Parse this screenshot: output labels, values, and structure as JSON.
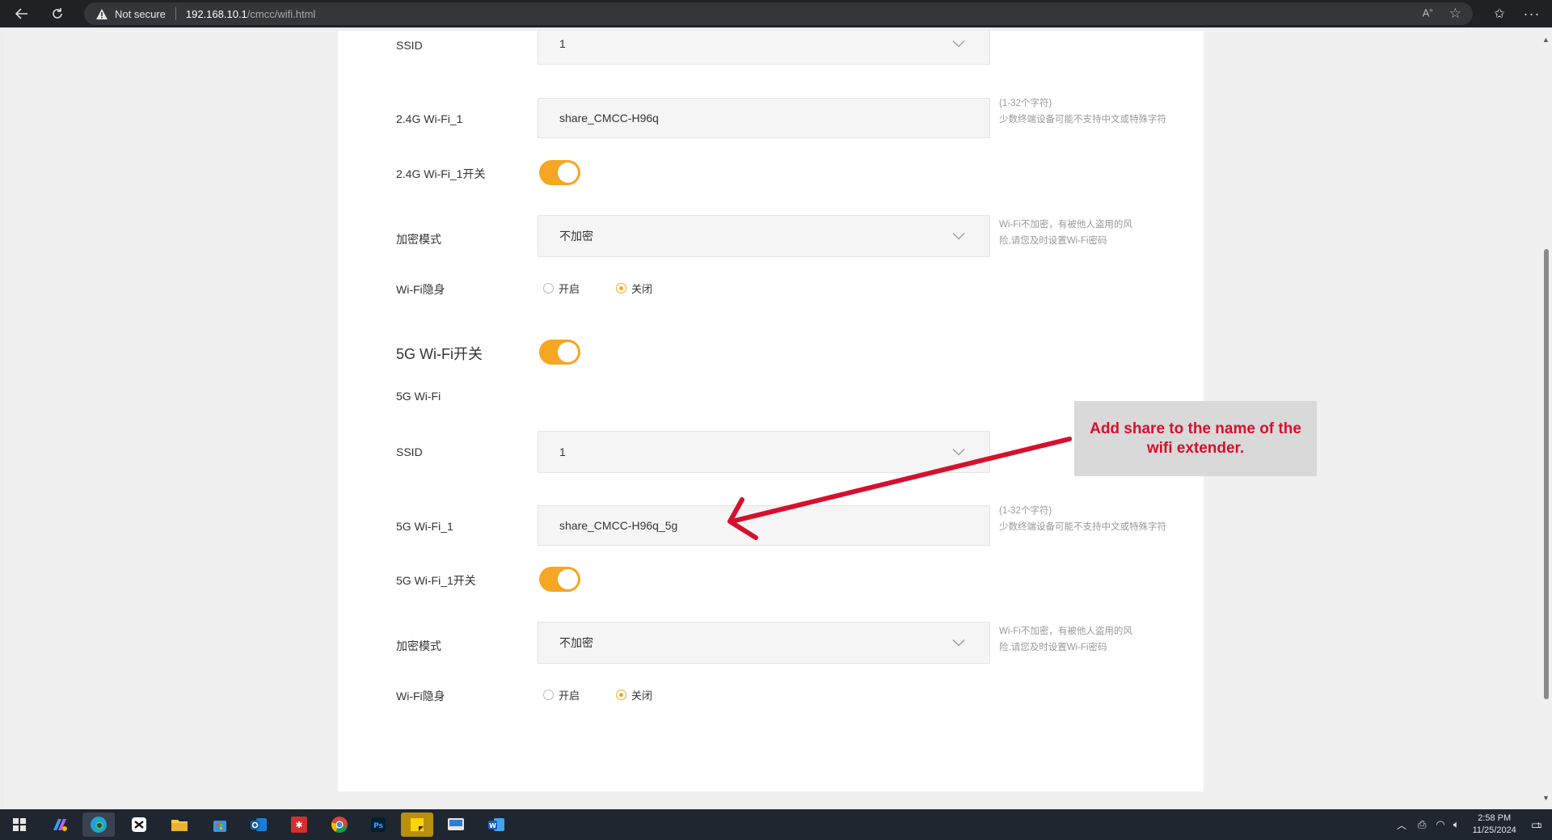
{
  "browser": {
    "security_label": "Not secure",
    "url_host": "192.168.10.1",
    "url_path": "/cmcc/wifi.html"
  },
  "wifi24": {
    "ssid_label": "SSID",
    "ssid_value": "1",
    "name_label": "2.4G Wi-Fi_1",
    "name_value": "share_CMCC-H96q",
    "name_hint_1": "(1-32个字符)",
    "name_hint_2": "少数终端设备可能不支持中文或特殊字符",
    "switch_label": "2.4G Wi-Fi_1开关",
    "switch_on": true,
    "encrypt_label": "加密模式",
    "encrypt_value": "不加密",
    "encrypt_hint_1": "Wi-Fi不加密，有被他人盗用的风",
    "encrypt_hint_2": "险,请您及时设置Wi-Fi密码",
    "hidden_label": "Wi-Fi隐身",
    "hidden_on_label": "开启",
    "hidden_off_label": "关闭",
    "hidden_selected": "关闭"
  },
  "wifi5": {
    "master_label": "5G Wi-Fi开关",
    "master_on": true,
    "section_label": "5G Wi-Fi",
    "ssid_label": "SSID",
    "ssid_value": "1",
    "name_label": "5G Wi-Fi_1",
    "name_value": "share_CMCC-H96q_5g",
    "name_hint_1": "(1-32个字符)",
    "name_hint_2": "少数终端设备可能不支持中文或特殊字符",
    "switch_label": "5G Wi-Fi_1开关",
    "switch_on": true,
    "encrypt_label": "加密模式",
    "encrypt_value": "不加密",
    "encrypt_hint_1": "Wi-Fi不加密，有被他人盗用的风",
    "encrypt_hint_2": "险,请您及时设置Wi-Fi密码",
    "hidden_label": "Wi-Fi隐身",
    "hidden_on_label": "开启",
    "hidden_off_label": "关闭",
    "hidden_selected": "关闭"
  },
  "annotation": {
    "text": "Add share to the name of the wifi extender.",
    "color": "#d6102e"
  },
  "taskbar": {
    "apps": [
      "windows-start",
      "copilot",
      "edge",
      "capcut",
      "file-explorer",
      "microsoft-store",
      "outlook",
      "app-red",
      "chrome",
      "photoshop",
      "sticky-notes",
      "snipping-tool",
      "word"
    ],
    "time": "2:58 PM",
    "date": "11/25/2024",
    "notification_count": "1"
  },
  "colors": {
    "accent": "#f5a623",
    "annotation_red": "#d6102e"
  }
}
